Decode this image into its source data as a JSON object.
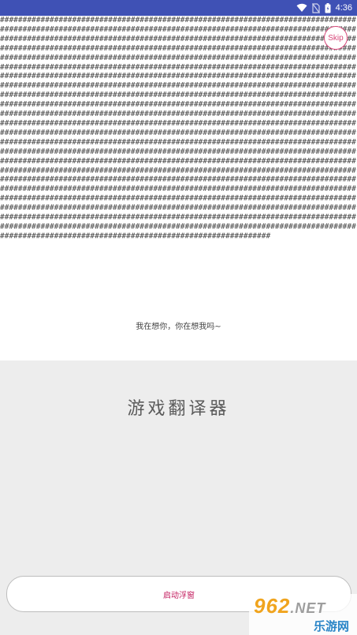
{
  "status_bar": {
    "time": "4:36"
  },
  "ad": {
    "placeholder_text": "#####################################################################################################################################################################################################################################################################################################################################################################################################################################################################################################################################################################################################################################################################################################################################################################################################################################################################################################################################################################################################################################################################################################################################################################################################################################################################################################################################################################################################################################################################################################################################################################################################################################################################################################################################################################################################################################################################################################################################################",
    "skip_label": "Skip"
  },
  "message": {
    "text": "我在想你，你在想我吗~"
  },
  "app": {
    "title": "游戏翻译器"
  },
  "actions": {
    "start_label": "启动浮窗"
  },
  "watermark": {
    "main": "962",
    "net": ".NET",
    "sub": "乐游网"
  },
  "colors": {
    "status_bar": "#3f51b5",
    "accent": "#c2185b",
    "skip": "#d8487a",
    "background": "#ededed"
  }
}
